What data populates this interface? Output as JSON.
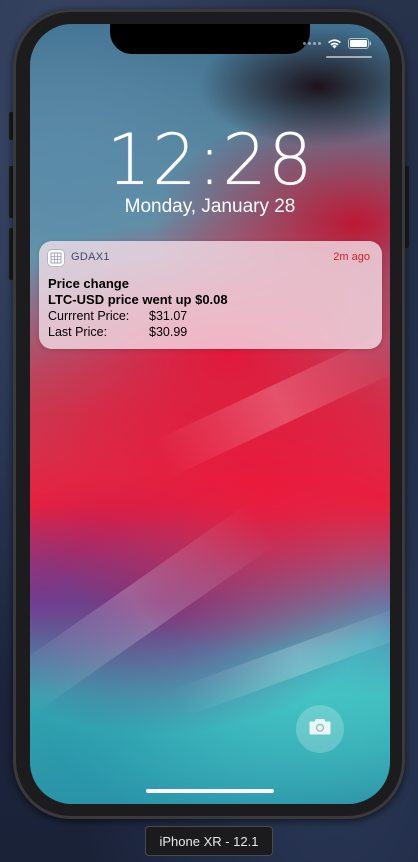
{
  "lock_screen": {
    "time": "12:28",
    "date": "Monday, January 28"
  },
  "status_bar": {
    "icons": [
      "signal-dots-icon",
      "wifi-icon",
      "battery-icon"
    ]
  },
  "notification": {
    "app_icon": "gdax-app-icon",
    "app_name": "GDAX1",
    "time_ago": "2m ago",
    "title": "Price change",
    "subtitle": "LTC-USD price went up $0.08",
    "lines": [
      {
        "label": "Currrent Price:",
        "value": "$31.07"
      },
      {
        "label": "Last Price:",
        "value": "$30.99"
      }
    ]
  },
  "camera_button": {
    "icon": "camera-icon"
  },
  "simulator": {
    "device_label": "iPhone XR - 12.1"
  },
  "colors": {
    "notification_time": "#d0202a",
    "app_name": "#3b4a6e",
    "notification_bg": "#f5e1eb"
  }
}
